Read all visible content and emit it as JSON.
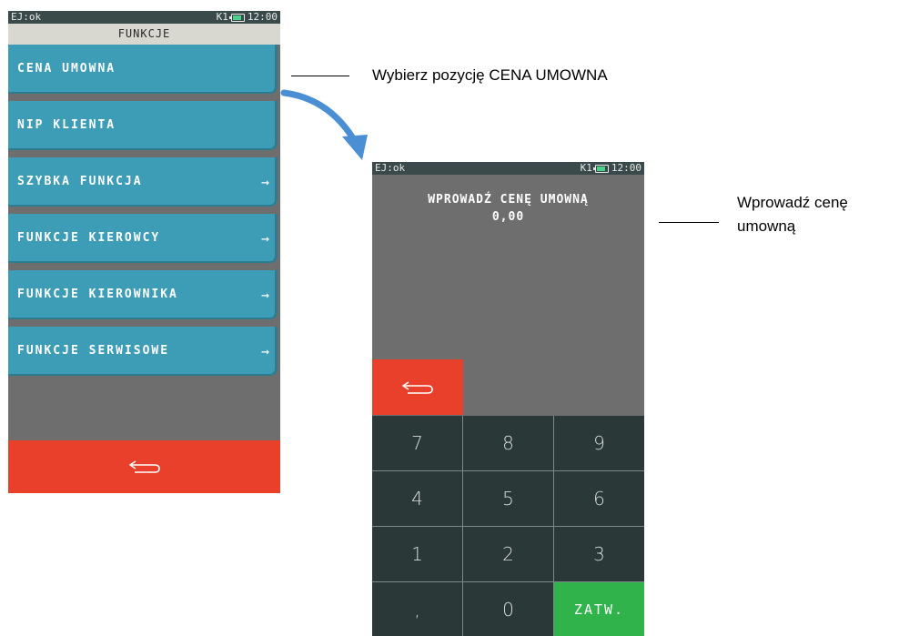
{
  "screen1": {
    "status": {
      "left": "EJ:ok",
      "terminal": "K1",
      "time": "12:00"
    },
    "title": "FUNKCJE",
    "menu": [
      {
        "label": "CENA UMOWNA",
        "arrow": ""
      },
      {
        "label": "NIP KLIENTA",
        "arrow": ""
      },
      {
        "label": "SZYBKA FUNKCJA",
        "arrow": "→"
      },
      {
        "label": "FUNKCJE KIEROWCY",
        "arrow": "→"
      },
      {
        "label": "FUNKCJE KIEROWNIKA",
        "arrow": "→"
      },
      {
        "label": "FUNKCJE SERWISOWE",
        "arrow": "→"
      }
    ],
    "back_icon": "back-arrow-icon"
  },
  "screen2": {
    "status": {
      "left": "EJ:ok",
      "terminal": "K1",
      "time": "12:00"
    },
    "prompt": "WPROWADŹ CENĘ UMOWNĄ",
    "value": "0,00",
    "keys": [
      "7",
      "8",
      "9",
      "4",
      "5",
      "6",
      "1",
      "2",
      "3",
      ",",
      "0",
      "ZATW."
    ]
  },
  "callouts": {
    "first": "Wybierz pozycję CENA UMOWNA",
    "second_line1": "Wprowadź cenę",
    "second_line2": "umowną"
  },
  "colors": {
    "menu": "#3d9db6",
    "back": "#e8402a",
    "confirm": "#2fb34a",
    "keypad": "#2b3838",
    "arrow": "#4a8fd4"
  }
}
